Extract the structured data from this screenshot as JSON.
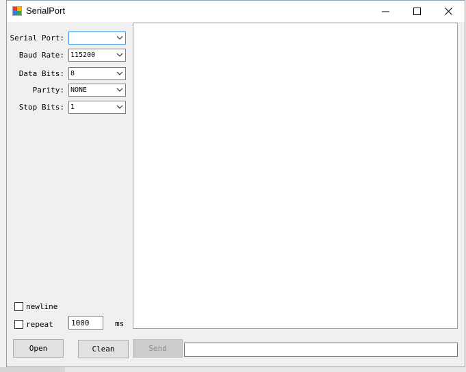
{
  "window": {
    "title": "SerialPort"
  },
  "settings": {
    "serial_port": {
      "label": "Serial Port:",
      "value": ""
    },
    "baud_rate": {
      "label": "Baud Rate:",
      "value": "115200"
    },
    "data_bits": {
      "label": "Data Bits:",
      "value": "8"
    },
    "parity": {
      "label": "Parity:",
      "value": "NONE"
    },
    "stop_bits": {
      "label": "Stop Bits:",
      "value": "1"
    }
  },
  "options": {
    "newline_label": "newline",
    "newline_checked": false,
    "repeat_label": "repeat",
    "repeat_checked": false,
    "repeat_interval": "1000",
    "repeat_unit": "ms"
  },
  "buttons": {
    "open": "Open",
    "clean": "Clean",
    "send": "Send"
  },
  "send_input": {
    "value": ""
  },
  "colors": {
    "focus_border": "#3c8be3",
    "window_bg": "#f0f0f0",
    "disabled_button": "#cccccc"
  }
}
